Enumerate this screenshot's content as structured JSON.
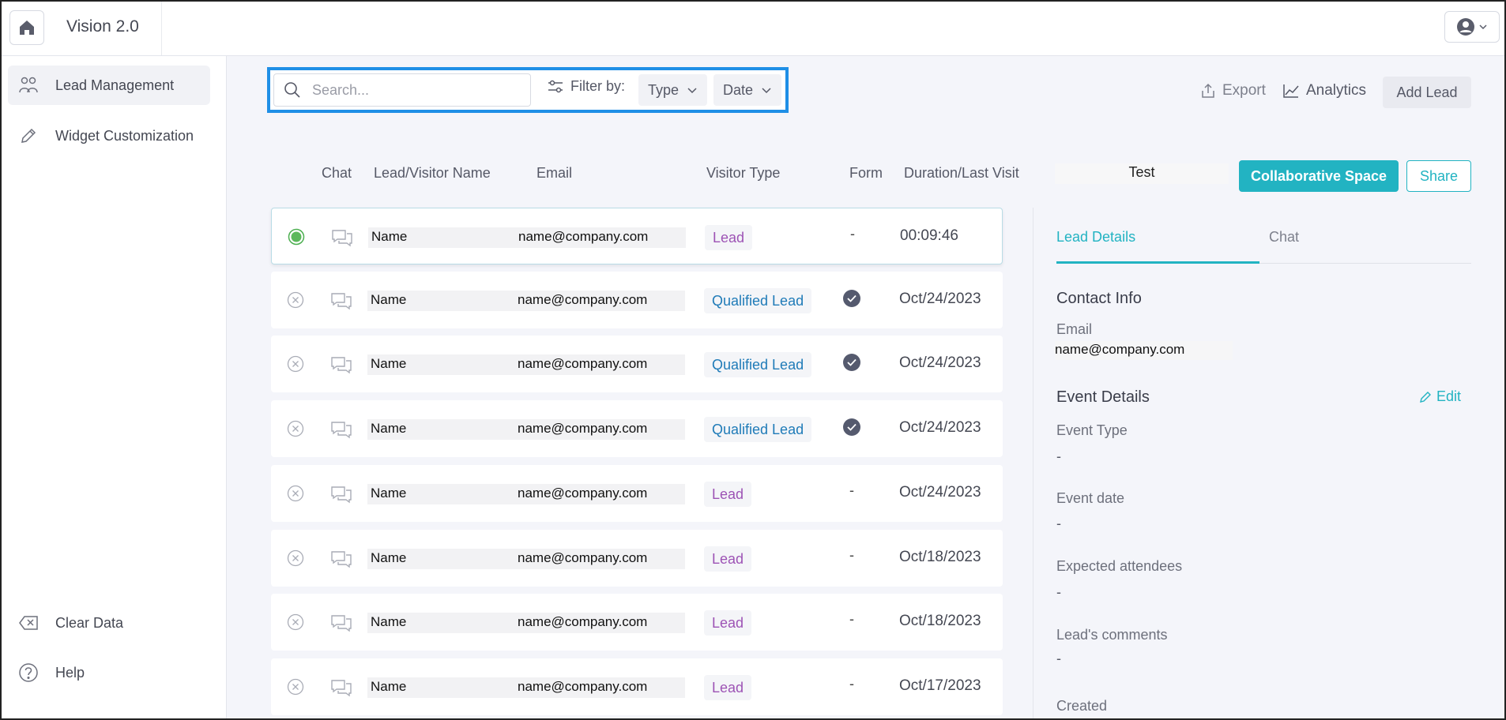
{
  "app": {
    "title": "Vision 2.0"
  },
  "icons": {
    "home": "home-icon",
    "user": "user-circle-icon",
    "search": "search-icon",
    "filter": "sliders-icon"
  },
  "colors": {
    "accent": "#22b3c2",
    "highlight": "#1f8fe6",
    "lead": "#9d53b5",
    "qualified": "#1f7bb8",
    "online": "#4caf50"
  },
  "sidebar": {
    "items": [
      {
        "label": "Lead Management",
        "icon": "users-icon",
        "active": true
      },
      {
        "label": "Widget Customization",
        "icon": "pencil-icon",
        "active": false
      }
    ],
    "bottom": [
      {
        "label": "Clear Data",
        "icon": "backspace-icon"
      },
      {
        "label": "Help",
        "icon": "help-icon"
      }
    ]
  },
  "toolbar": {
    "search_placeholder": "Search...",
    "filter_label": "Filter by:",
    "filter_type": "Type",
    "filter_date": "Date",
    "export": "Export",
    "analytics": "Analytics",
    "add_lead": "Add Lead"
  },
  "table": {
    "headers": [
      "Chat",
      "Lead/Visitor Name",
      "Email",
      "Visitor Type",
      "Form",
      "Duration/Last Visit"
    ],
    "rows": [
      {
        "name": "Name",
        "email": "name@company.com",
        "type": "Lead",
        "form": "-",
        "date": "00:09:46",
        "status": "online"
      },
      {
        "name": "Name",
        "email": "name@company.com",
        "type": "Qualified Lead",
        "form": "check",
        "date": "Oct/24/2023",
        "status": "offline"
      },
      {
        "name": "Name",
        "email": "name@company.com",
        "type": "Qualified Lead",
        "form": "check",
        "date": "Oct/24/2023",
        "status": "offline"
      },
      {
        "name": "Name",
        "email": "name@company.com",
        "type": "Qualified Lead",
        "form": "check",
        "date": "Oct/24/2023",
        "status": "offline"
      },
      {
        "name": "Name",
        "email": "name@company.com",
        "type": "Lead",
        "form": "-",
        "date": "Oct/24/2023",
        "status": "offline"
      },
      {
        "name": "Name",
        "email": "name@company.com",
        "type": "Lead",
        "form": "-",
        "date": "Oct/18/2023",
        "status": "offline"
      },
      {
        "name": "Name",
        "email": "name@company.com",
        "type": "Lead",
        "form": "-",
        "date": "Oct/18/2023",
        "status": "offline"
      },
      {
        "name": "Name",
        "email": "name@company.com",
        "type": "Lead",
        "form": "-",
        "date": "Oct/17/2023",
        "status": "offline"
      }
    ]
  },
  "detail": {
    "test_label": "Test",
    "collab_button": "Collaborative Space",
    "share_button": "Share",
    "tabs": [
      "Lead Details",
      "Chat"
    ],
    "contact_title": "Contact Info",
    "email_label": "Email",
    "email_value": "name@company.com",
    "event_title": "Event Details",
    "edit": "Edit",
    "fields": [
      {
        "label": "Event Type",
        "value": "-"
      },
      {
        "label": "Event date",
        "value": "-"
      },
      {
        "label": "Expected attendees",
        "value": "-"
      },
      {
        "label": "Lead's comments",
        "value": "-"
      }
    ],
    "created_label": "Created"
  }
}
